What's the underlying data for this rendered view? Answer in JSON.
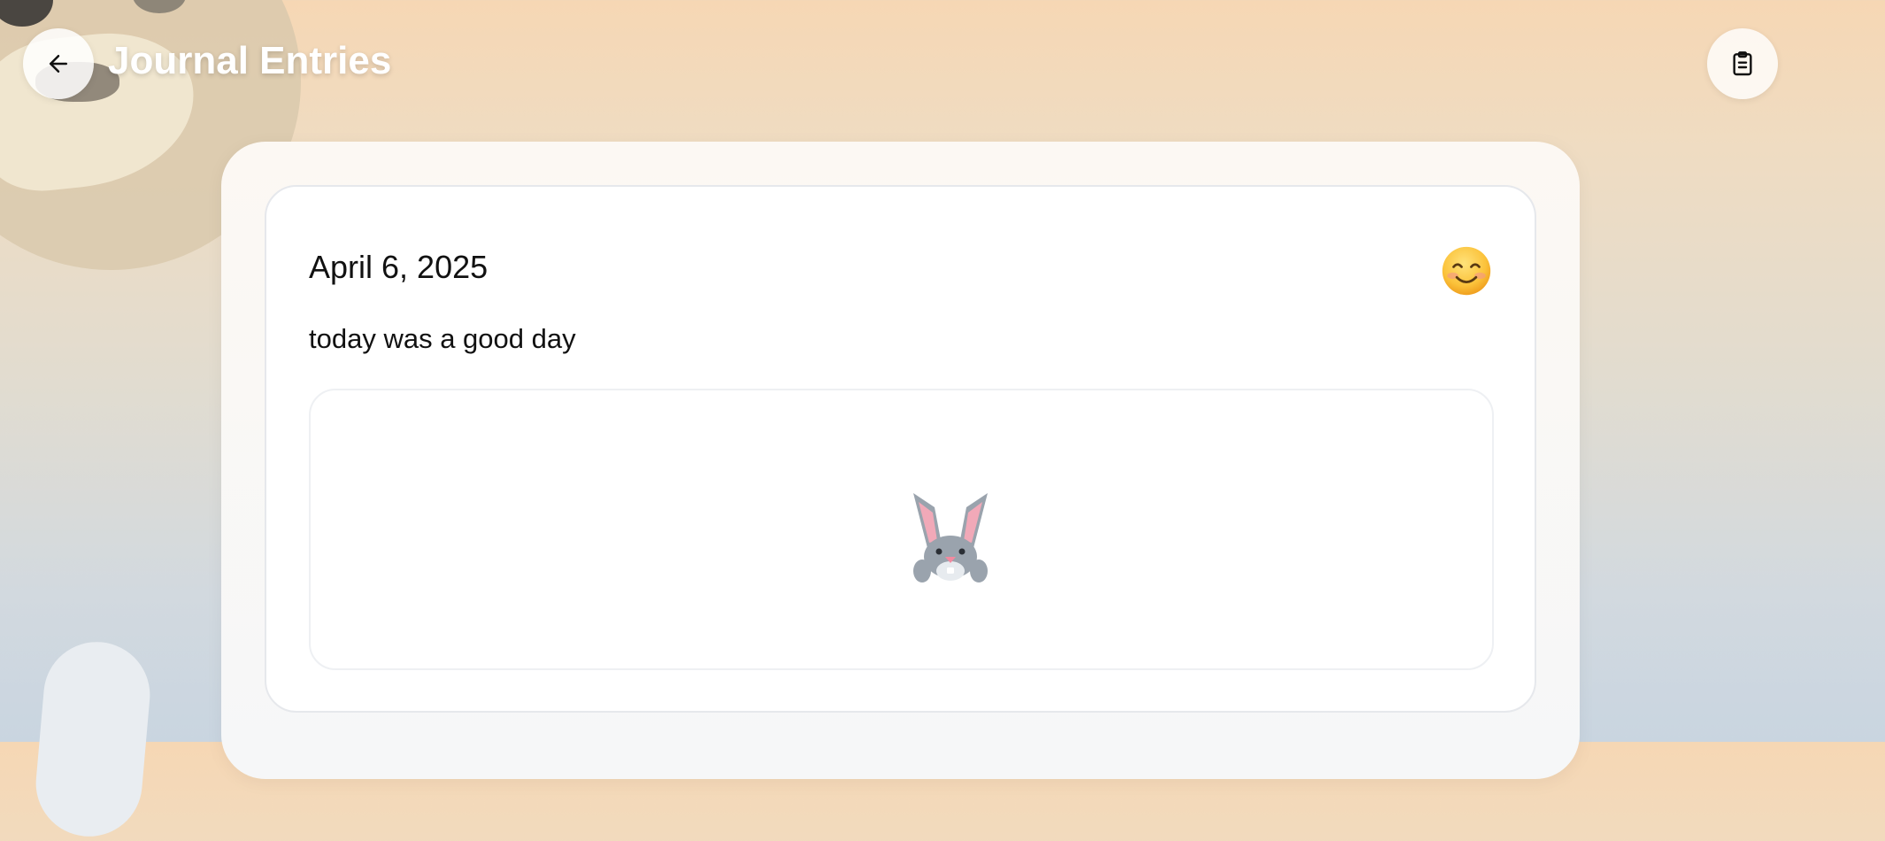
{
  "header": {
    "title": "Journal Entries",
    "back_icon": "arrow-left-icon",
    "action_icon": "clipboard-icon"
  },
  "entry": {
    "date": "April 6, 2025",
    "text": "today was a good day",
    "mood_icon": "smiling-face-icon",
    "image_icon": "rabbit-face-icon"
  },
  "colors": {
    "background_top": "#f6d7b4",
    "background_bottom": "#c9d5e0",
    "card": "#ffffff",
    "text": "#111111"
  }
}
